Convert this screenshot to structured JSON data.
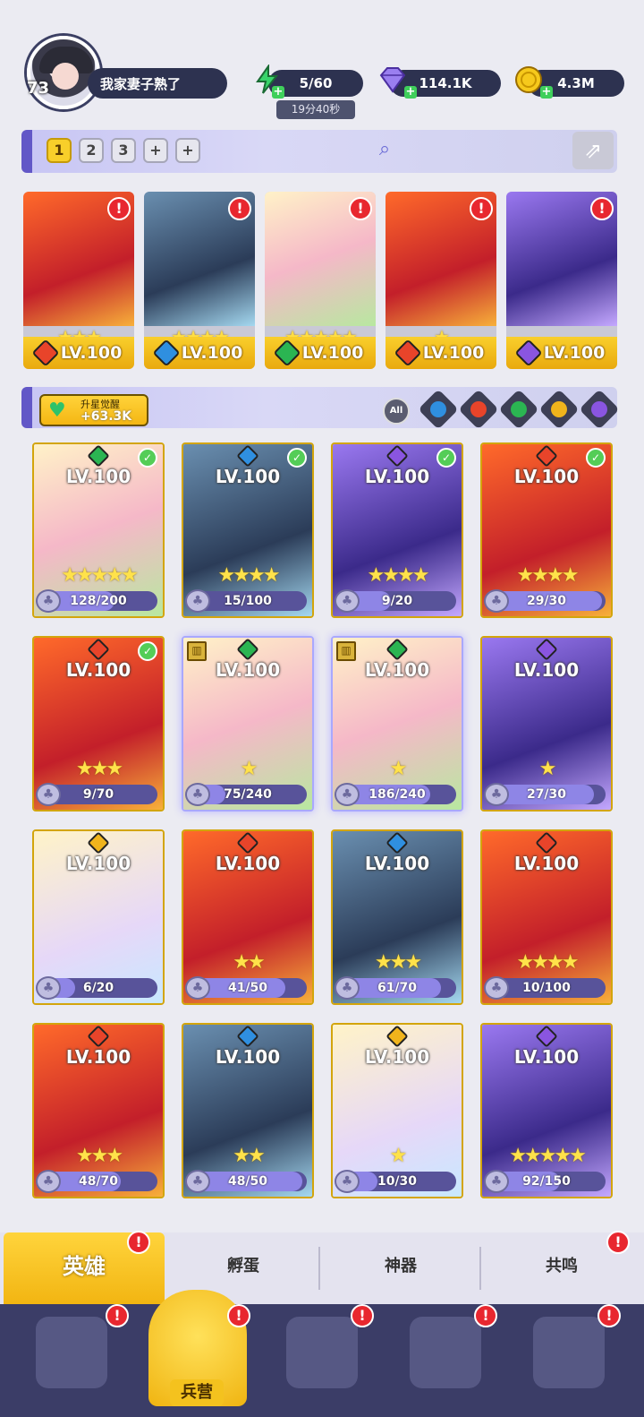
{
  "profile": {
    "level": "73",
    "name": "我家妻子熟了"
  },
  "resources": {
    "energy": "5/60",
    "energy_timer": "19分40秒",
    "gems": "114.1K",
    "coins": "4.3M"
  },
  "teams": {
    "tabs": [
      "1",
      "2",
      "3",
      "+",
      "+"
    ],
    "active": "1"
  },
  "team_slots": [
    {
      "level": "LV.100",
      "stars": "★★★",
      "element": "fire"
    },
    {
      "level": "LV.100",
      "stars": "★★★★",
      "element": "water"
    },
    {
      "level": "LV.100",
      "stars": "★★★★★",
      "element": "nature"
    },
    {
      "level": "LV.100",
      "stars": "★",
      "element": "fire"
    },
    {
      "level": "LV.100",
      "stars": "",
      "element": "dark"
    }
  ],
  "awaken": {
    "title": "升星觉醒",
    "value": "+63.3K"
  },
  "filters": [
    "All",
    "water",
    "fire",
    "nature",
    "light",
    "dark"
  ],
  "heroes": [
    {
      "level": "LV.100",
      "element": "nature",
      "check": true,
      "stars": "★★★★★",
      "frag": "128/200",
      "progress": 0.64
    },
    {
      "level": "LV.100",
      "element": "water",
      "check": true,
      "stars": "★★★★",
      "frag": "15/100",
      "progress": 0.15
    },
    {
      "level": "LV.100",
      "element": "dark",
      "check": true,
      "stars": "★★★★",
      "frag": "9/20",
      "progress": 0.45
    },
    {
      "level": "LV.100",
      "element": "fire",
      "check": true,
      "stars": "★★★★",
      "frag": "29/30",
      "progress": 0.97
    },
    {
      "level": "LV.100",
      "element": "fire",
      "check": true,
      "stars": "★★★",
      "frag": "9/70",
      "progress": 0.13
    },
    {
      "level": "LV.100",
      "element": "nature",
      "check": false,
      "badge": true,
      "stars": "★",
      "frag": "75/240",
      "progress": 0.31
    },
    {
      "level": "LV.100",
      "element": "nature",
      "check": false,
      "badge": true,
      "stars": "★",
      "frag": "186/240",
      "progress": 0.78
    },
    {
      "level": "LV.100",
      "element": "dark",
      "check": false,
      "stars": "★",
      "frag": "27/30",
      "progress": 0.9
    },
    {
      "level": "LV.100",
      "element": "light",
      "check": false,
      "stars": "",
      "frag": "6/20",
      "progress": 0.3
    },
    {
      "level": "LV.100",
      "element": "fire",
      "check": false,
      "stars": "★★",
      "frag": "41/50",
      "progress": 0.82
    },
    {
      "level": "LV.100",
      "element": "water",
      "check": false,
      "stars": "★★★",
      "frag": "61/70",
      "progress": 0.87
    },
    {
      "level": "LV.100",
      "element": "fire",
      "check": false,
      "stars": "★★★★",
      "frag": "10/100",
      "progress": 0.1
    },
    {
      "level": "LV.100",
      "element": "fire",
      "check": false,
      "stars": "★★★",
      "frag": "48/70",
      "progress": 0.69
    },
    {
      "level": "LV.100",
      "element": "water",
      "check": false,
      "stars": "★★",
      "frag": "48/50",
      "progress": 0.96
    },
    {
      "level": "LV.100",
      "element": "light",
      "check": false,
      "stars": "★",
      "frag": "10/30",
      "progress": 0.33
    },
    {
      "level": "LV.100",
      "element": "dark",
      "check": false,
      "stars": "★★★★★",
      "frag": "92/150",
      "progress": 0.61
    }
  ],
  "subtabs": [
    "英雄",
    "孵蛋",
    "神器",
    "共鸣"
  ],
  "bottom_nav": {
    "active_label": "兵营"
  },
  "element_colors": {
    "fire": "#e8442a",
    "water": "#2f8fe0",
    "nature": "#2bb552",
    "dark": "#8a55e0",
    "light": "#f0b41c"
  }
}
